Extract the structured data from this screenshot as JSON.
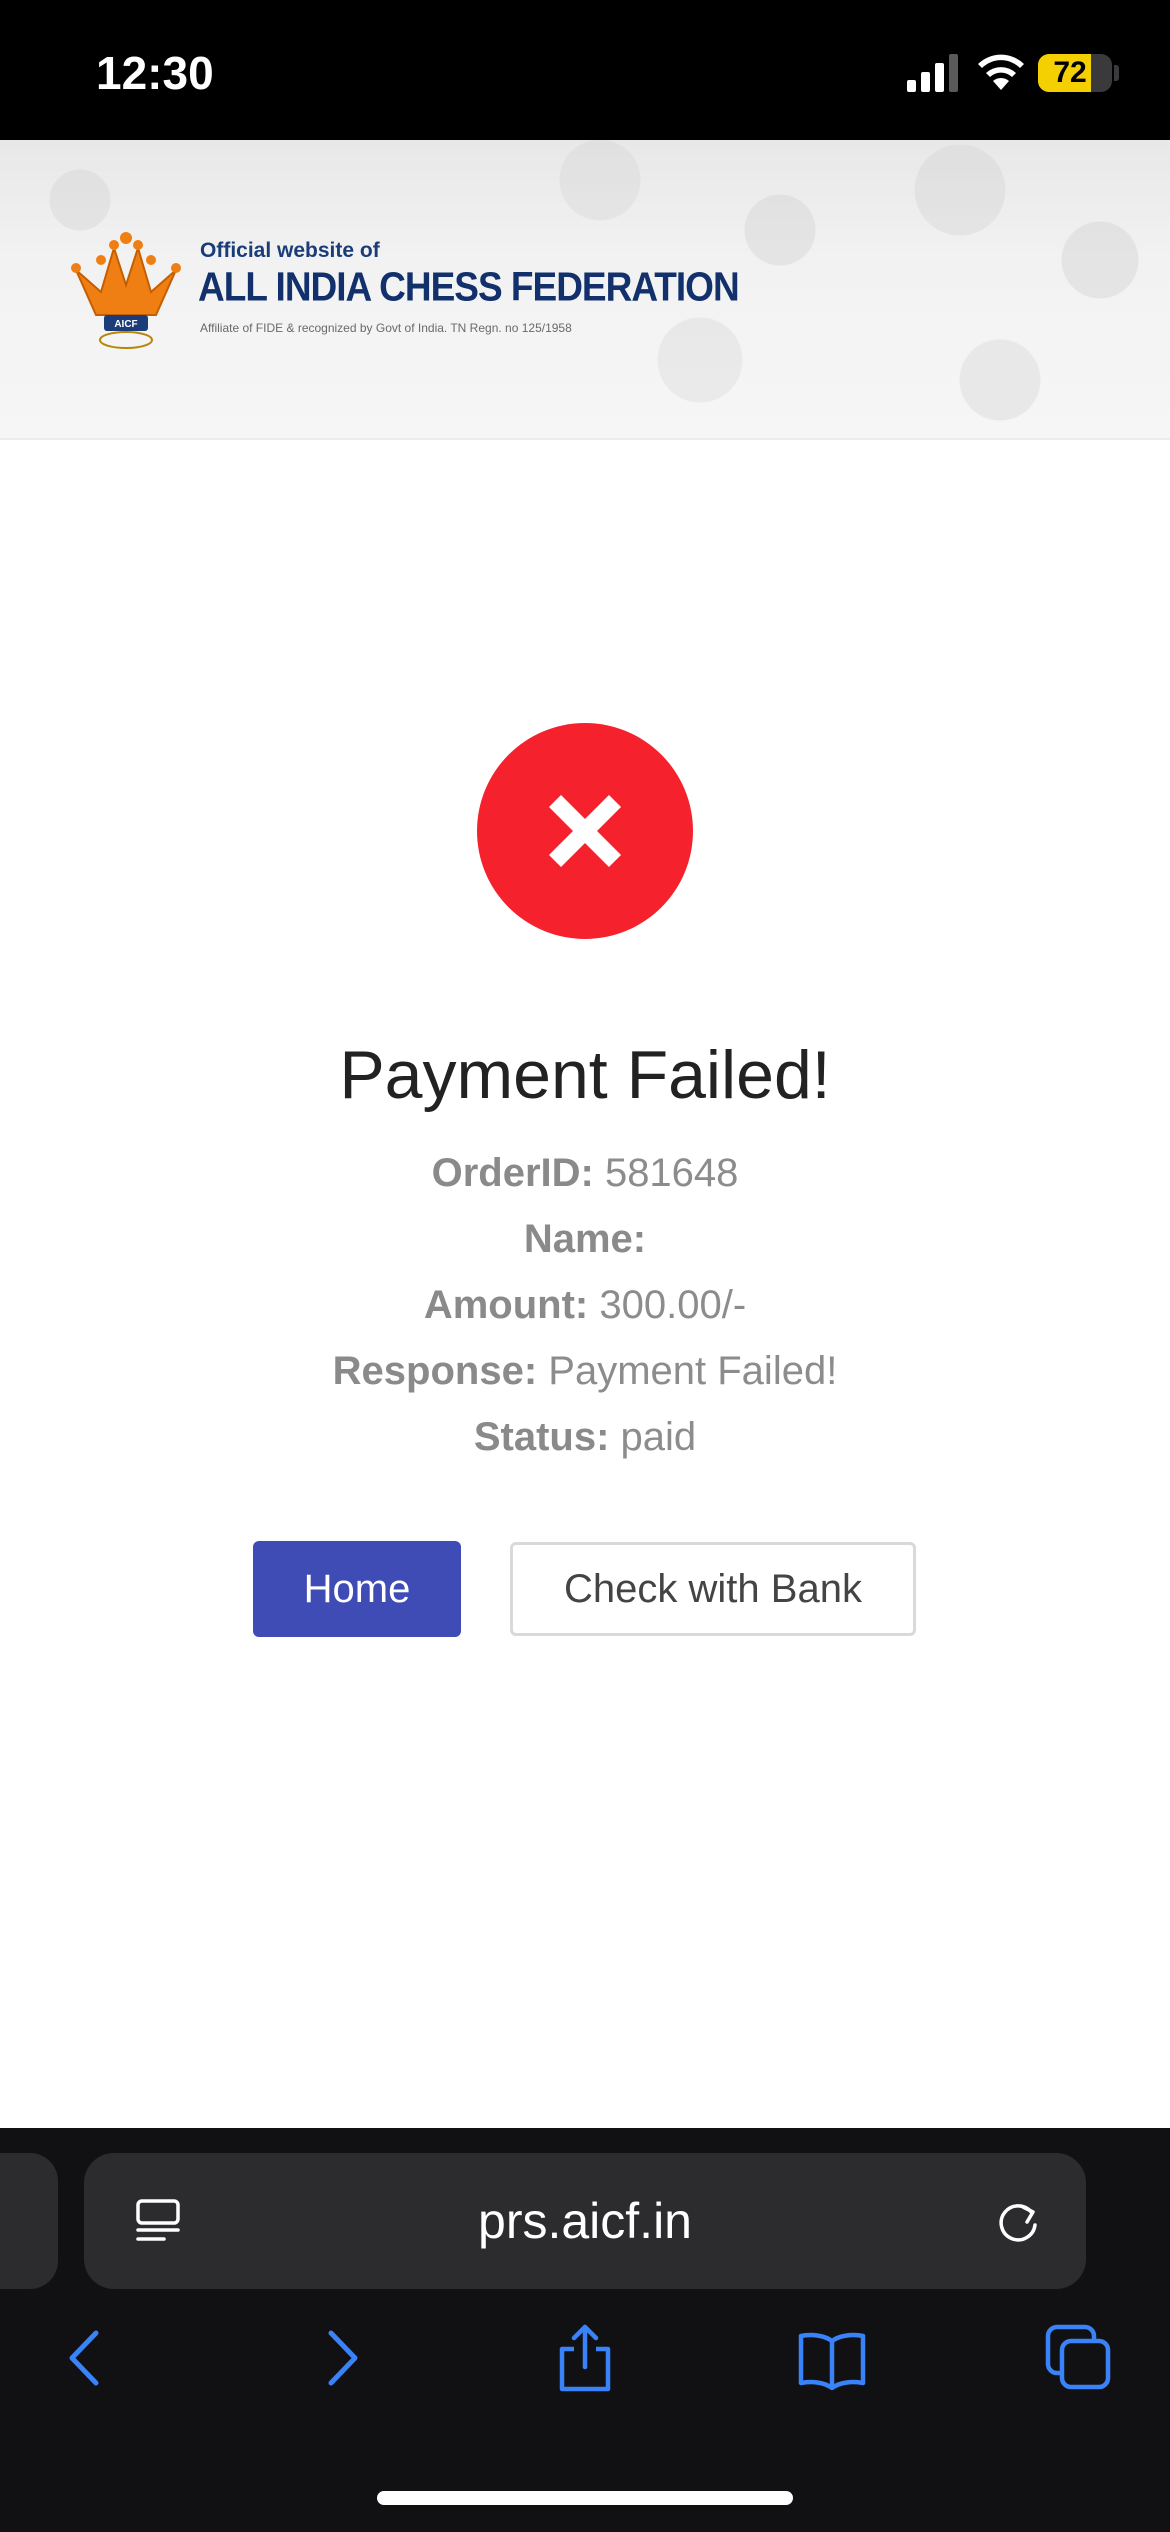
{
  "status_bar": {
    "time": "12:30",
    "battery_level": "72",
    "battery_fraction": 0.72
  },
  "header": {
    "subtitle": "Official website of",
    "title": "ALL INDIA CHESS FEDERATION",
    "tagline": "Affiliate of FIDE & recognized by Govt of India. TN Regn. no 125/1958",
    "logo_text": "AICF"
  },
  "result": {
    "icon": "x-icon",
    "heading": "Payment Failed!",
    "details": [
      {
        "label": "OrderID:",
        "value": " 581648"
      },
      {
        "label": "Name:",
        "value": ""
      },
      {
        "label": "Amount:",
        "value": " 300.00/-"
      },
      {
        "label": "Response:",
        "value": " Payment Failed!"
      },
      {
        "label": "Status:",
        "value": " paid"
      }
    ]
  },
  "actions": {
    "home_label": "Home",
    "bank_label": "Check with Bank"
  },
  "browser": {
    "url": "prs.aicf.in"
  },
  "colors": {
    "fail_red": "#f5222d",
    "primary_button": "#3f4cb5",
    "browser_accent": "#3a82f7"
  }
}
